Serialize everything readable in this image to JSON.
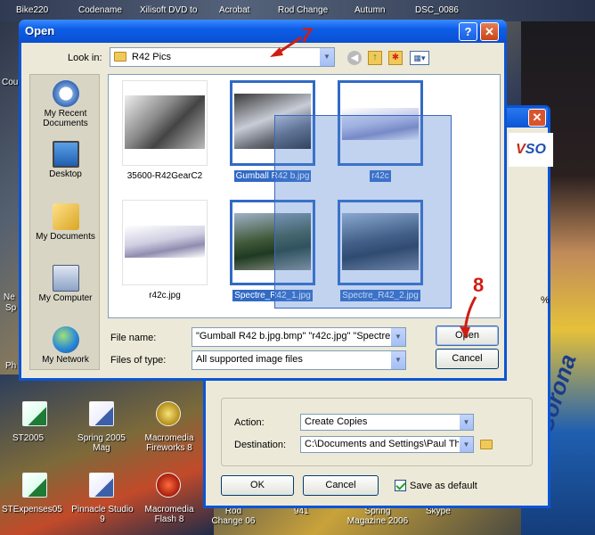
{
  "desktop": {
    "top_icons": [
      "Bike220",
      "Codename",
      "Xilisoft DVD to",
      "Acrobat",
      "Rod Change",
      "Autumn",
      "DSC_0086"
    ],
    "left_partial_labels": [
      "Cou",
      "Ne",
      "Sp",
      "Ph"
    ],
    "bottom_icons": [
      {
        "label": "ST2005",
        "icon": "excel-icon"
      },
      {
        "label": "Spring 2005 Mag",
        "icon": "word-icon"
      },
      {
        "label": "Macromedia Fireworks 8",
        "icon": "fireworks-icon"
      },
      {
        "label": "STExpenses05",
        "icon": "excel-icon"
      },
      {
        "label": "Pinnacle Studio 9",
        "icon": "word-icon"
      },
      {
        "label": "Macromedia Flash 8",
        "icon": "flash-icon"
      }
    ],
    "bottom_strip_labels": [
      "Rod Change 06",
      "941",
      "Spring Magazine 2006",
      "Skype"
    ],
    "brand_text": "Corona"
  },
  "background_dialog": {
    "logo": "VSO",
    "action_label": "Action:",
    "action_value": "Create Copies",
    "destination_label": "Destination:",
    "destination_value": "C:\\Documents and Settings\\Paul Thor",
    "ok_label": "OK",
    "cancel_label": "Cancel",
    "save_default_label": "Save as default",
    "save_default_checked": true,
    "partial_text": "%"
  },
  "open_dialog": {
    "title": "Open",
    "help_button": "?",
    "close_button": "✕",
    "look_in_label": "Look in:",
    "look_in_value": "R42 Pics",
    "places": [
      "My Recent Documents",
      "Desktop",
      "My Documents",
      "My Computer",
      "My Network"
    ],
    "files": [
      {
        "name": "35600-R42GearC2",
        "selected": false
      },
      {
        "name": "Gumball R42 b.jpg",
        "selected": true
      },
      {
        "name": "r42c",
        "selected": true
      },
      {
        "name": "r42c.jpg",
        "selected": false
      },
      {
        "name": "Spectre_R42_1.jpg",
        "selected": true
      },
      {
        "name": "Spectre_R42_2.jpg",
        "selected": true
      }
    ],
    "file_name_label": "File name:",
    "file_name_value": "\"Gumball R42 b.jpg.bmp\" \"r42c.jpg\" \"Spectre_",
    "files_of_type_label": "Files of type:",
    "files_of_type_value": "All supported image files",
    "open_button": "Open",
    "cancel_button": "Cancel"
  },
  "annotations": [
    "7",
    "8"
  ]
}
